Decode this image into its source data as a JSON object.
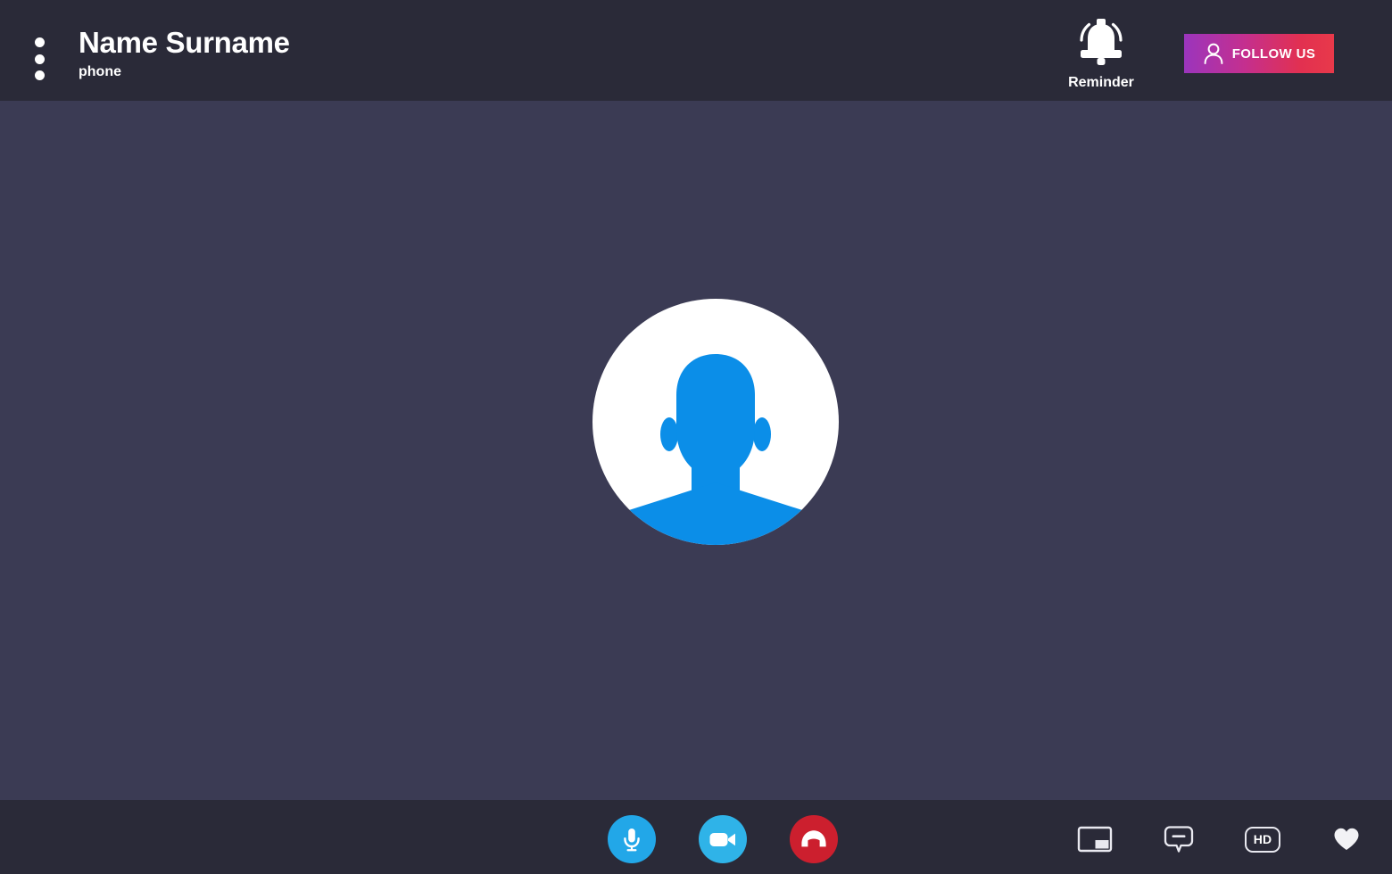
{
  "header": {
    "menu_icon": "three-dots-vertical-icon",
    "caller_name": "Name Surname",
    "caller_subtitle": "phone",
    "reminder": {
      "icon": "bell-ringing-icon",
      "label": "Reminder"
    },
    "follow": {
      "icon": "user-outline-icon",
      "label": "FOLLOW US",
      "gradient_from": "#9b35bd",
      "gradient_to": "#e8394a"
    }
  },
  "stage": {
    "avatar": {
      "icon": "user-avatar-placeholder-icon",
      "circle_color": "#ffffff",
      "person_color": "#0b8ee8"
    },
    "background_color": "#3b3b54"
  },
  "footer": {
    "background_color": "#2a2a38",
    "call_controls": [
      {
        "name": "microphone-button",
        "icon": "microphone-icon",
        "color": "#22a7e8"
      },
      {
        "name": "video-button",
        "icon": "video-camera-icon",
        "color": "#2fb3e8"
      },
      {
        "name": "hangup-button",
        "icon": "phone-hangup-icon",
        "color": "#cc1f2e"
      }
    ],
    "util_controls": [
      {
        "name": "picture-in-picture-button",
        "icon": "picture-in-picture-icon"
      },
      {
        "name": "chat-button",
        "icon": "chat-bubble-icon"
      },
      {
        "name": "hd-button",
        "icon": "hd-badge-icon",
        "label": "HD"
      },
      {
        "name": "favorite-button",
        "icon": "heart-icon"
      }
    ]
  }
}
